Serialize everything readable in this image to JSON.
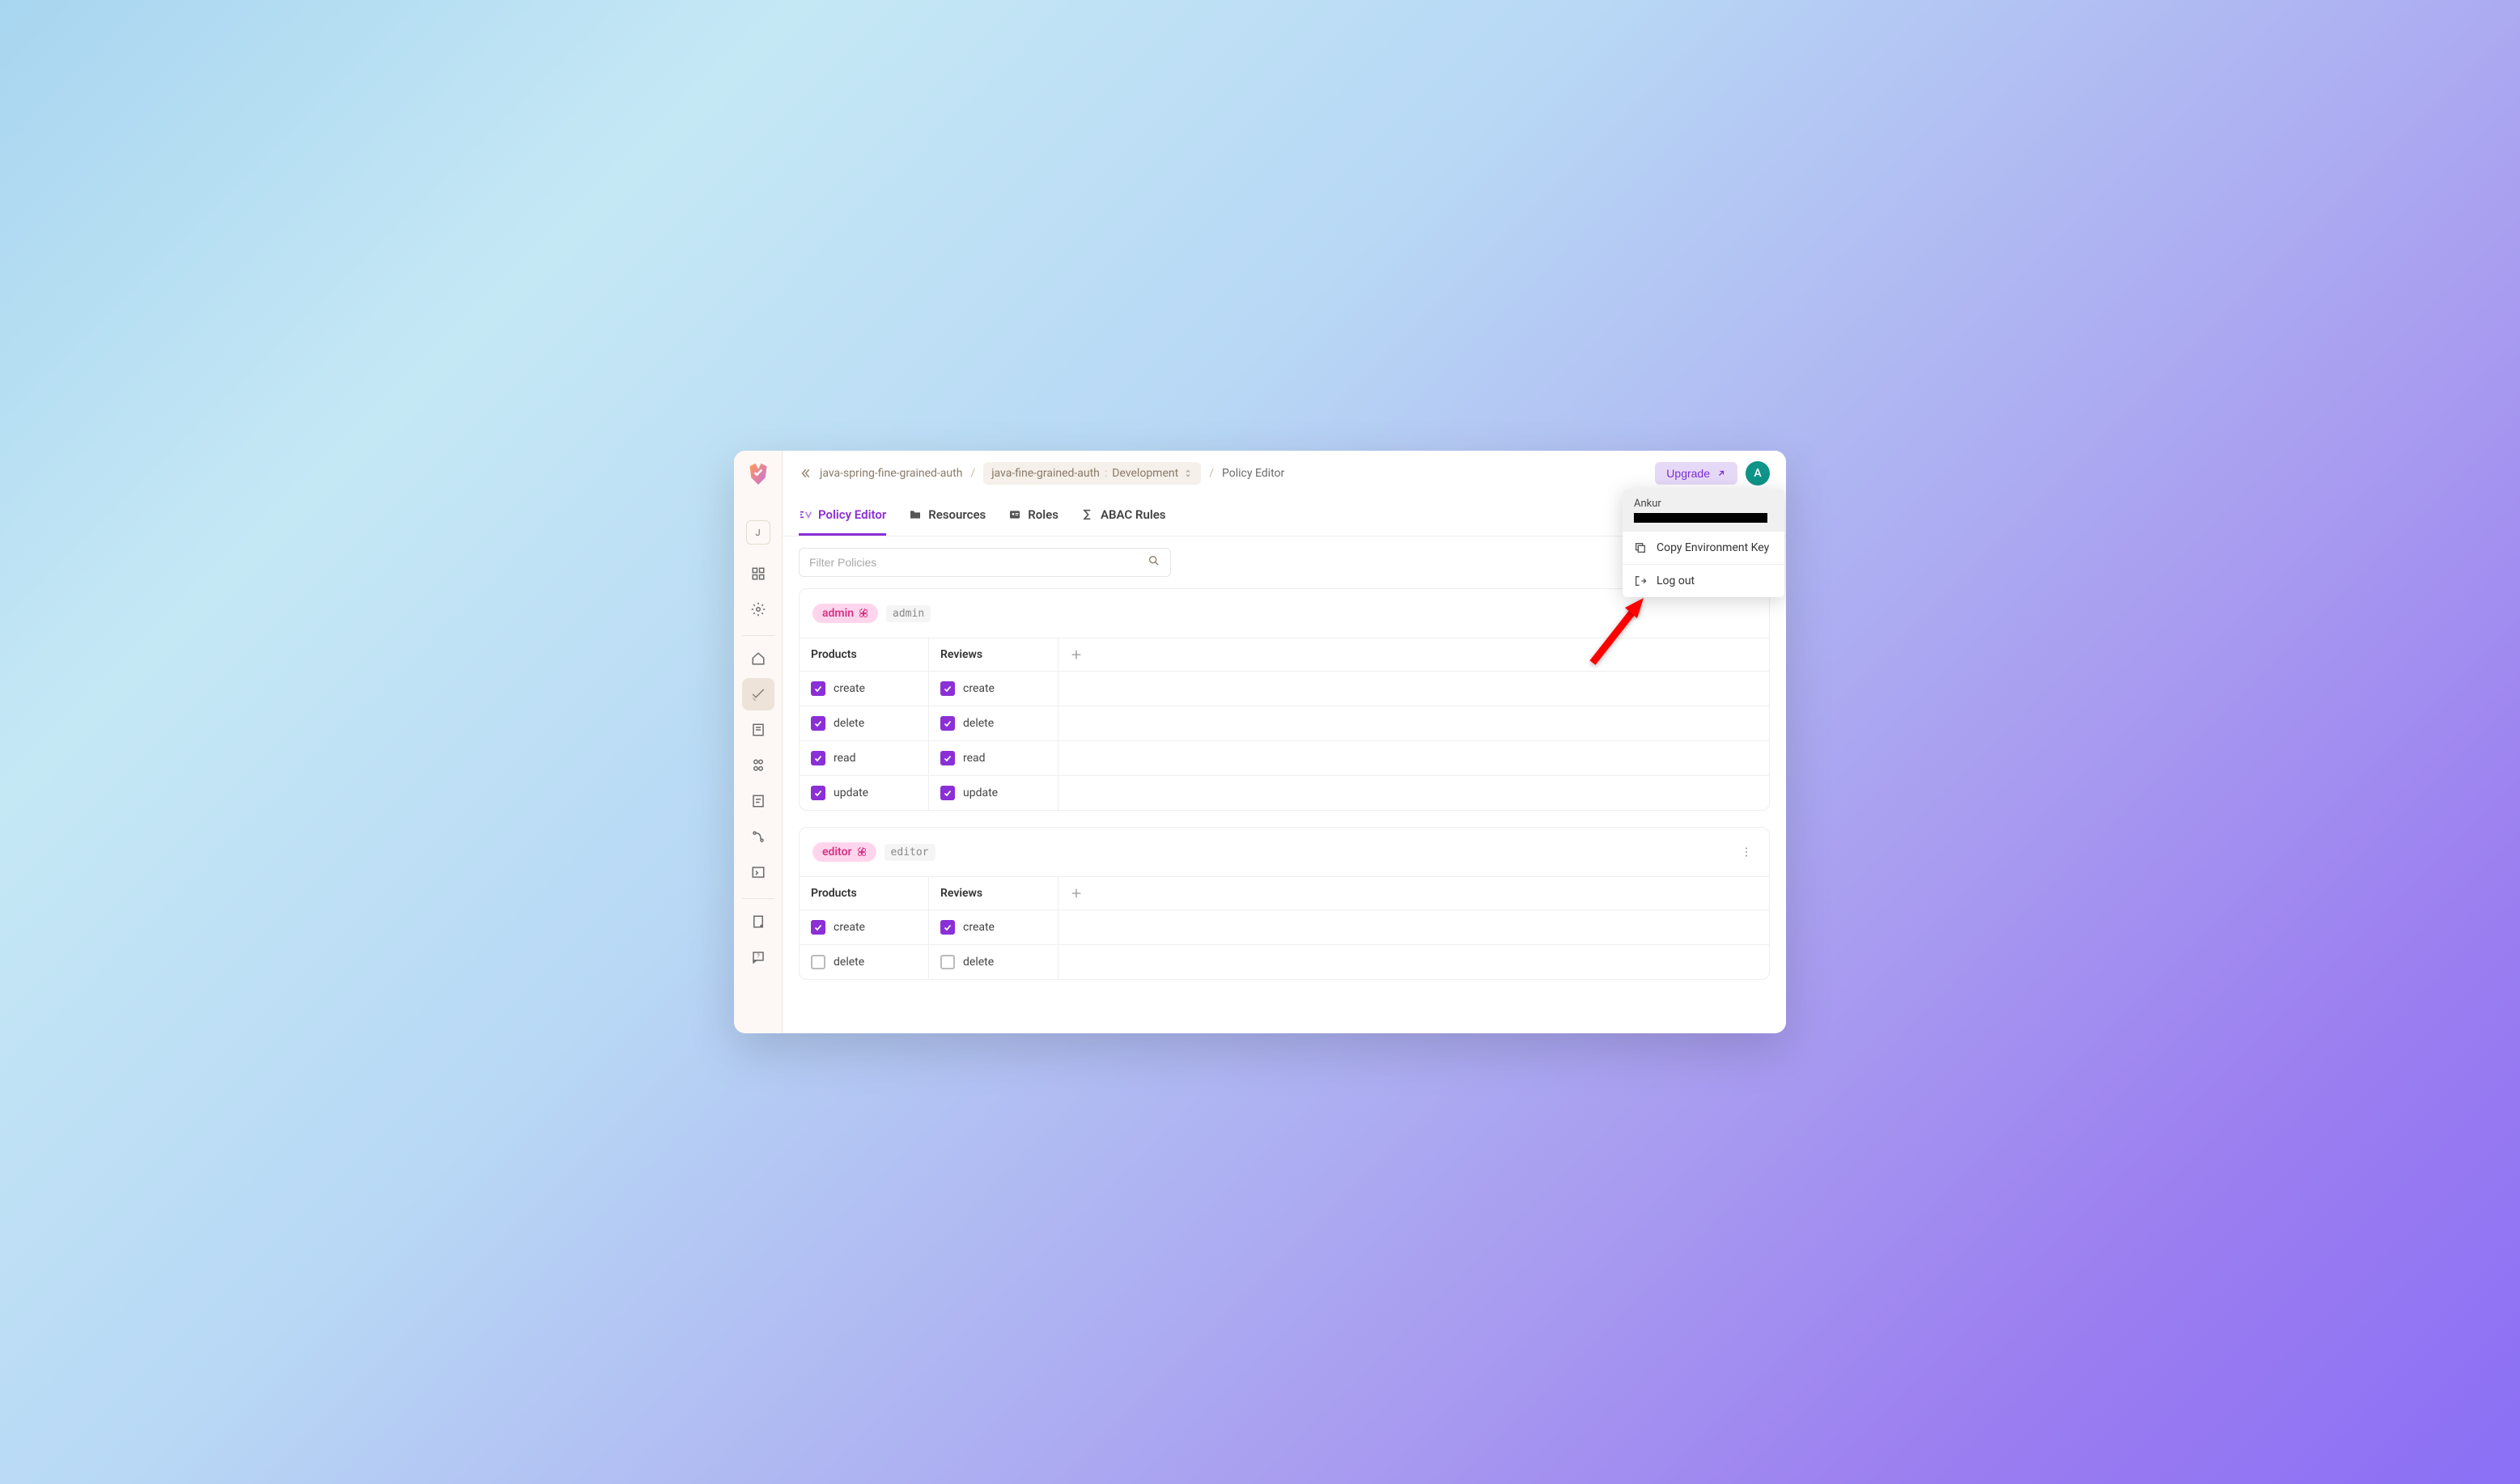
{
  "sidebar": {
    "workspace_badge": "J"
  },
  "breadcrumb": {
    "project": "java-spring-fine-grained-auth",
    "app": "java-fine-grained-auth",
    "env": "Development",
    "current": "Policy Editor"
  },
  "topbar": {
    "upgrade": "Upgrade",
    "avatar_letter": "A"
  },
  "tabs": [
    {
      "label": "Policy Editor"
    },
    {
      "label": "Resources"
    },
    {
      "label": "Roles"
    },
    {
      "label": "ABAC Rules"
    }
  ],
  "toolbar": {
    "filter_placeholder": "Filter Policies",
    "settings": "Settings"
  },
  "resource_columns": [
    "Products",
    "Reviews"
  ],
  "roles": [
    {
      "name": "admin",
      "key": "admin",
      "rows": [
        {
          "products": {
            "label": "create",
            "checked": true
          },
          "reviews": {
            "label": "create",
            "checked": true
          }
        },
        {
          "products": {
            "label": "delete",
            "checked": true
          },
          "reviews": {
            "label": "delete",
            "checked": true
          }
        },
        {
          "products": {
            "label": "read",
            "checked": true
          },
          "reviews": {
            "label": "read",
            "checked": true
          }
        },
        {
          "products": {
            "label": "update",
            "checked": true
          },
          "reviews": {
            "label": "update",
            "checked": true
          }
        }
      ],
      "show_kebab": false
    },
    {
      "name": "editor",
      "key": "editor",
      "rows": [
        {
          "products": {
            "label": "create",
            "checked": true
          },
          "reviews": {
            "label": "create",
            "checked": true
          }
        },
        {
          "products": {
            "label": "delete",
            "checked": false
          },
          "reviews": {
            "label": "delete",
            "checked": false
          }
        }
      ],
      "show_kebab": true
    }
  ],
  "dropdown": {
    "user_name": "Ankur",
    "copy_env": "Copy Environment Key",
    "logout": "Log out"
  }
}
